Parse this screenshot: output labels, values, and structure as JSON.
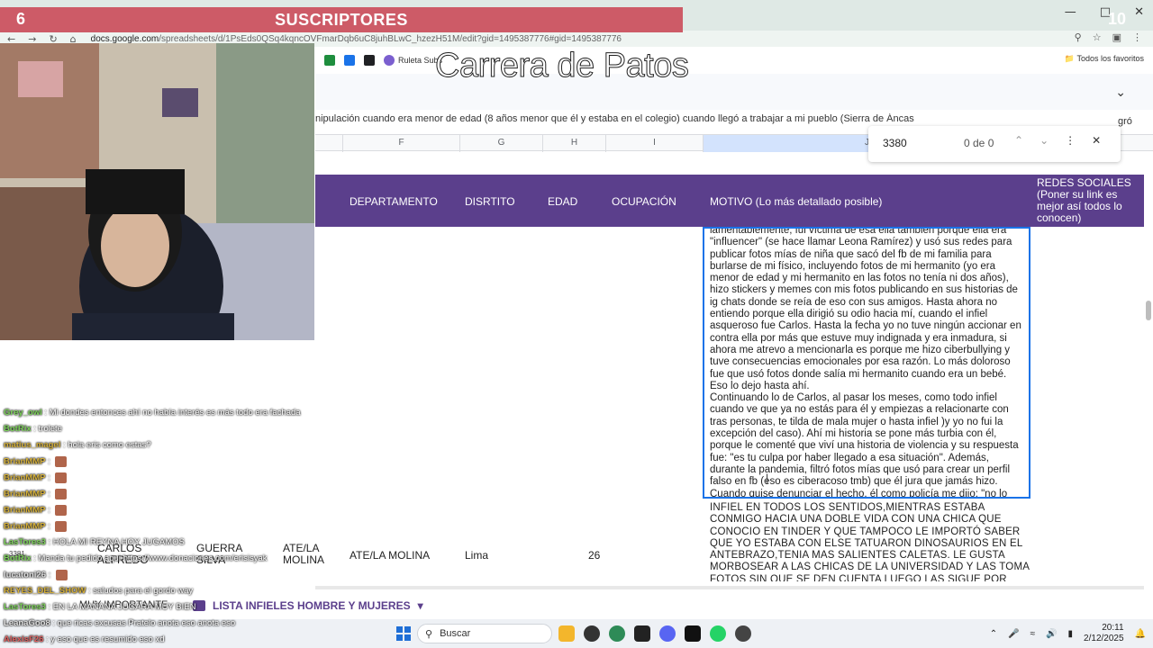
{
  "overlay": {
    "subs_left": "6",
    "subs_title": "SUSCRIPTORES",
    "subs_right": "10",
    "race_title": "Carrera de Patos"
  },
  "browser": {
    "url_domain": "docs.google.com",
    "url_path": "/spreadsheets/d/1PsEds0QSq4kqncOVFmarDqb6uC8juhBLwC_hzezH51M/edit?gid=1495387776#gid=1495387776",
    "bookmark_label": "Ruleta Subs",
    "bookmarks_right": "Todos los favoritos"
  },
  "sheet": {
    "formula_text": "nipulación cuando era menor de edad (8 años menor que él y estaba en el colegio) cuando llegó a trabajar a mi pueblo (Sierra de Áncas",
    "formula_tail": "gró",
    "columns": [
      "F",
      "G",
      "H",
      "I",
      "J"
    ],
    "find": {
      "query": "3380",
      "count": "0 de 0"
    },
    "headers": {
      "departamento": "DEPARTAMENTO",
      "distrito": "DISRTITO",
      "edad": "EDAD",
      "ocupacion": "OCUPACIÓN",
      "motivo": "MOTIVO (Lo más detallado posible)",
      "redes": "REDES SOCIALES (Poner su link es mejor así todos lo conocen)"
    },
    "motivo_text": "lamentablemente, fui víctima de esa ella también porque ella era \"influencer\" (se hace llamar Leona Ramírez) y usó sus redes para publicar fotos mías de niña que sacó del fb de mi familia para burlarse de mi físico, incluyendo fotos de mi hermanito (yo era menor de edad y mi hermanito en las fotos no tenía ni dos años), hizo stickers y memes con mis fotos publicando en sus historias de ig chats donde se reía de eso con sus amigos. Hasta ahora no entiendo porque ella dirigió su odio hacia mí, cuando el infiel asqueroso fue Carlos. Hasta la fecha yo no tuve ningún accionar en contra ella por más que estuve muy indignada y era inmadura, si ahora me atrevo a mencionarla es porque me hizo ciberbullying y tuve consecuencias emocionales por esa razón. Lo más doloroso fue que usó fotos donde salía mi hermanito cuando era un bebé. Eso lo dejo hasta ahí.\nContinuando lo de Carlos, al pasar los meses, como todo infiel cuando ve que ya no estás para él y empiezas a relacionarte con tras personas, te tilda de mala mujer o hasta infiel )y yo no fui la excepción del caso). Ahí mi historia se pone más turbia con él, porque le comenté que viví una historia de violencia y su respuesta fue: \"es tu culpa por haber llegado a esa situación\". Además, durante la pandemia, filtró fotos mías que usó para crear un perfil falso en fb (eso es ciberacoso tmb) que él jura que jamás hizo. Cuando quise denunciar el hecho, él como policía me dijo: \"no lo hagas, o terminarás peor y con más vergüenza\" (rarísimo).",
    "row2": {
      "row_num": "3381",
      "nombre": "CARLOS ALFREDO",
      "apellido": "GUERRA SILVA",
      "departamento_a": "ATE/LA MOLINA",
      "departamento_b": "ATE/LA MOLINA",
      "distrito": "Lima",
      "edad": "26",
      "motivo": "INFIEL EN TODOS LOS SENTIDOS,MIENTRAS ESTABA CONMIGO HACIA UNA DOBLE VIDA CON UNA CHICA QUE CONOCIO EN TINDER Y QUE TAMPOCO LE IMPORTÓ SABER QUE YO ESTABA CON ELSE TATUARON DINOSAURIOS EN EL ANTEBRAZO,TENIA MAS SALIENTES CALETAS. LE GUSTA MORBOSEAR A LAS CHICAS DE LA UNIVERSIDAD Y LAS TOMA FOTOS SIN QUE SE DEN CUENTA LUEGO LAS SIGUE POR TIKTOK Y LAS COMPARA"
    },
    "tabs": {
      "active": "LISTA INFIELES HOMBRE Y MUJERES",
      "other": "MUY IMPORTANTE"
    }
  },
  "taskbar": {
    "search": "Buscar",
    "time": "20:11",
    "date": "2/12/2025",
    "badge": "99+"
  },
  "chat": [
    {
      "user": "Grey_owl",
      "msg": "Mi dondes entonces ahí no había interés es más todo era fachada",
      "color": "#7dd35a"
    },
    {
      "user": "BotRix",
      "msg": "trolete",
      "color": "#7dd35a"
    },
    {
      "user": "matius_magel",
      "msg": "hola eris  como estas?",
      "color": "#d6b13a"
    },
    {
      "user": "BrianMMP",
      "msg": "",
      "color": "#d6b13a"
    },
    {
      "user": "BrianMMP",
      "msg": "",
      "color": "#d6b13a"
    },
    {
      "user": "BrianMMP",
      "msg": "",
      "color": "#d6b13a"
    },
    {
      "user": "BrianMMP",
      "msg": "",
      "color": "#d6b13a"
    },
    {
      "user": "BrianMMP",
      "msg": "",
      "color": "#d6b13a"
    },
    {
      "user": "LasTores3",
      "msg": "HOLA MI REYNA HOY JUGAMOS",
      "color": "#7dd35a"
    },
    {
      "user": "BotRix",
      "msg": "Manda tu pedido aqui https://www.donaciones.com/erisisyak",
      "color": "#7dd35a"
    },
    {
      "user": "lucatoni26",
      "msg": "",
      "color": "#e0e0e0"
    },
    {
      "user": "REYES_DEL_SHOW",
      "msg": "saludos para el gordo way",
      "color": "#d6b13a"
    },
    {
      "user": "LasTores3",
      "msg": "EN LA MAÑANA JUGARA MUY BIEN",
      "color": "#7dd35a"
    },
    {
      "user": "LeanaGoo8",
      "msg": "que ricas excusas Pratelo anota eso anota eso",
      "color": "#e0e0e0"
    },
    {
      "user": "AlexisF26",
      "msg": "y eso que es resumido eso xd",
      "color": "#e06060"
    }
  ]
}
